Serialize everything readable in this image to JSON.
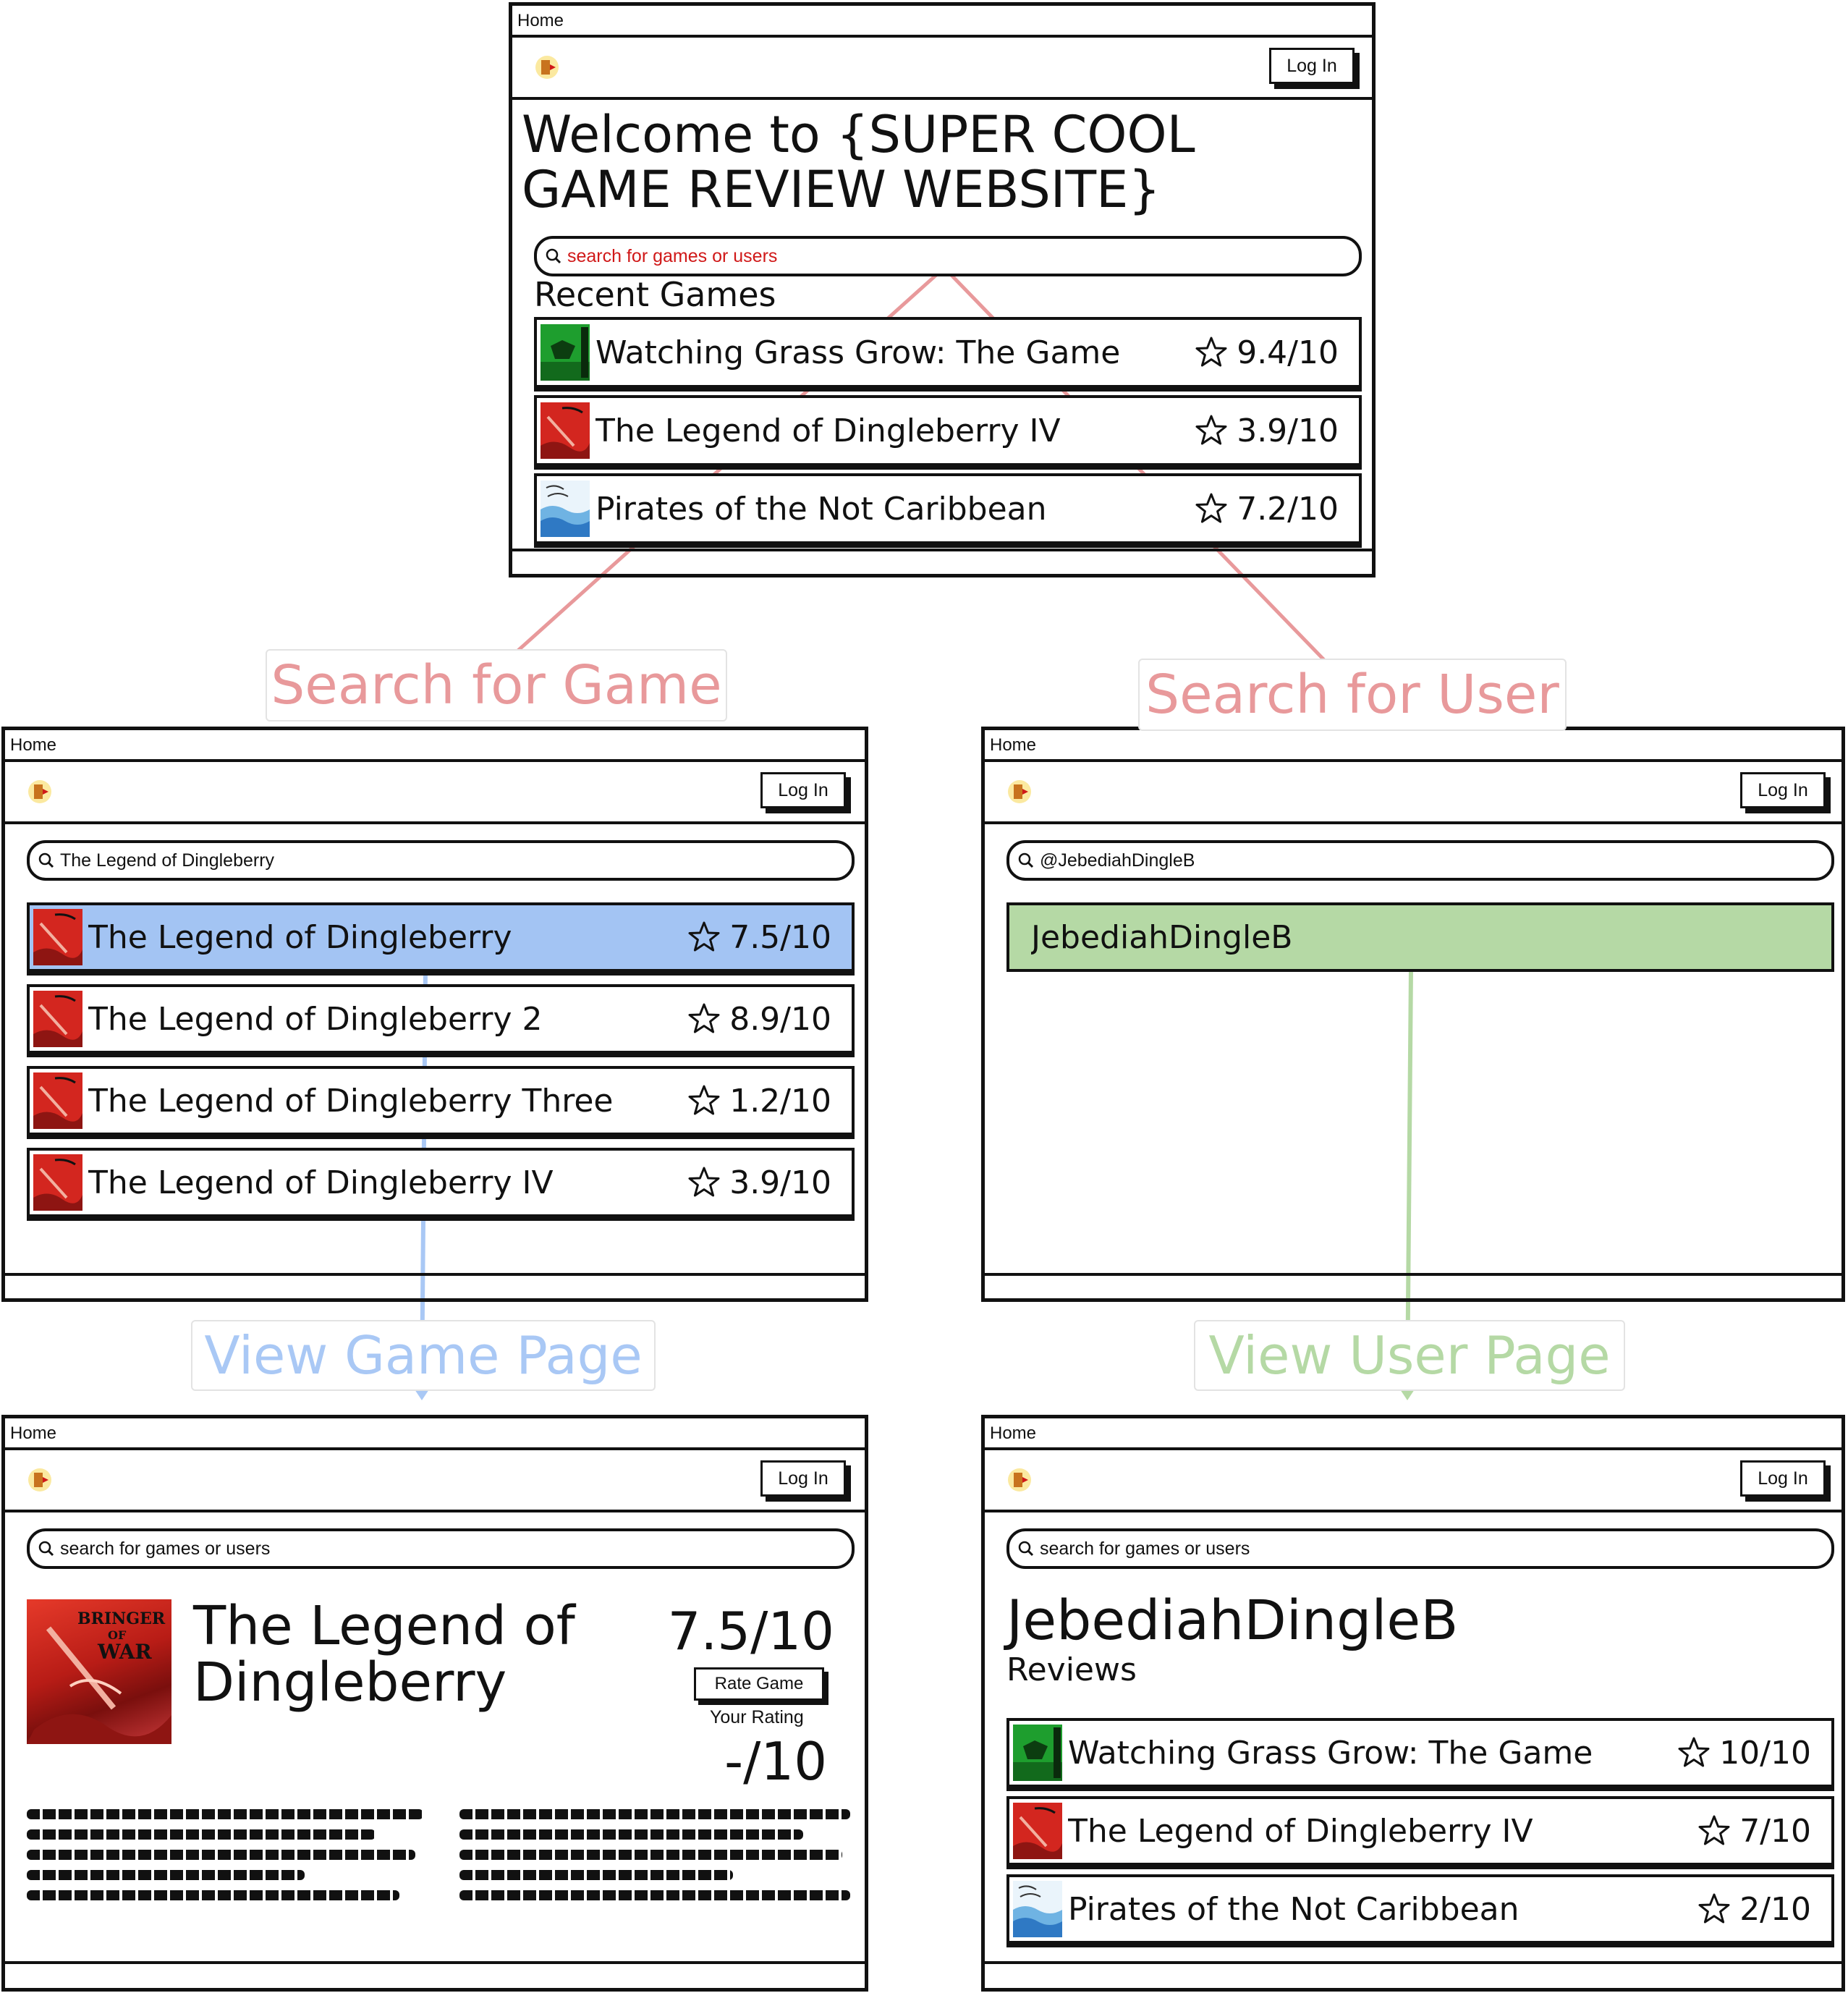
{
  "home_screen": {
    "tab_title": "Home",
    "login_label": "Log In",
    "heading_line1": "Welcome to {SUPER COOL",
    "heading_line2": "GAME REVIEW WEBSITE}",
    "search_placeholder": "search for games or users",
    "recent_heading": "Recent Games",
    "recent_games": [
      {
        "title": "Watching Grass Grow: The Game",
        "score": "9.4/10",
        "thumb": "grass"
      },
      {
        "title": "The Legend of Dingleberry IV",
        "score": "3.9/10",
        "thumb": "war"
      },
      {
        "title": "Pirates of the Not Caribbean",
        "score": "7.2/10",
        "thumb": "water"
      }
    ]
  },
  "flow_labels": {
    "search_game": "Search for Game",
    "search_user": "Search for User",
    "view_game": "View Game Page",
    "view_user": "View User Page"
  },
  "colors": {
    "search_flow": "#e8999b",
    "game_flow": "#a9c8f5",
    "user_flow": "#b5d9a5",
    "selected_game_row": "#a3c4f3",
    "selected_user_row": "#b5d9a5",
    "search_placeholder_red": "#d01818"
  },
  "game_search_screen": {
    "tab_title": "Home",
    "login_label": "Log In",
    "search_value": "The Legend of Dingleberry",
    "results": [
      {
        "title": "The Legend of Dingleberry",
        "score": "7.5/10",
        "thumb": "war",
        "selected": true
      },
      {
        "title": "The Legend of Dingleberry 2",
        "score": "8.9/10",
        "thumb": "war"
      },
      {
        "title": "The Legend of Dingleberry Three",
        "score": "1.2/10",
        "thumb": "war"
      },
      {
        "title": "The Legend of Dingleberry IV",
        "score": "3.9/10",
        "thumb": "war"
      }
    ]
  },
  "user_search_screen": {
    "tab_title": "Home",
    "login_label": "Log In",
    "search_value": "@JebediahDingleB",
    "result": "JebediahDingleB"
  },
  "game_page": {
    "tab_title": "Home",
    "login_label": "Log In",
    "search_placeholder": "search for games or users",
    "title_line1": "The Legend of",
    "title_line2": "Dingleberry",
    "cover_text_line1": "BRINGER",
    "cover_text_line2": "OF",
    "cover_text_line3": "WAR",
    "score": "7.5/10",
    "rate_button": "Rate Game",
    "your_rating_label": "Your Rating",
    "your_rating": "-/10"
  },
  "user_page": {
    "tab_title": "Home",
    "login_label": "Log In",
    "search_placeholder": "search for games or users",
    "username": "JebediahDingleB",
    "reviews_heading": "Reviews",
    "reviews": [
      {
        "title": "Watching Grass Grow: The Game",
        "score": "10/10",
        "thumb": "grass"
      },
      {
        "title": "The Legend of Dingleberry IV",
        "score": "7/10",
        "thumb": "war"
      },
      {
        "title": "Pirates of the Not Caribbean",
        "score": "2/10",
        "thumb": "water"
      }
    ]
  }
}
